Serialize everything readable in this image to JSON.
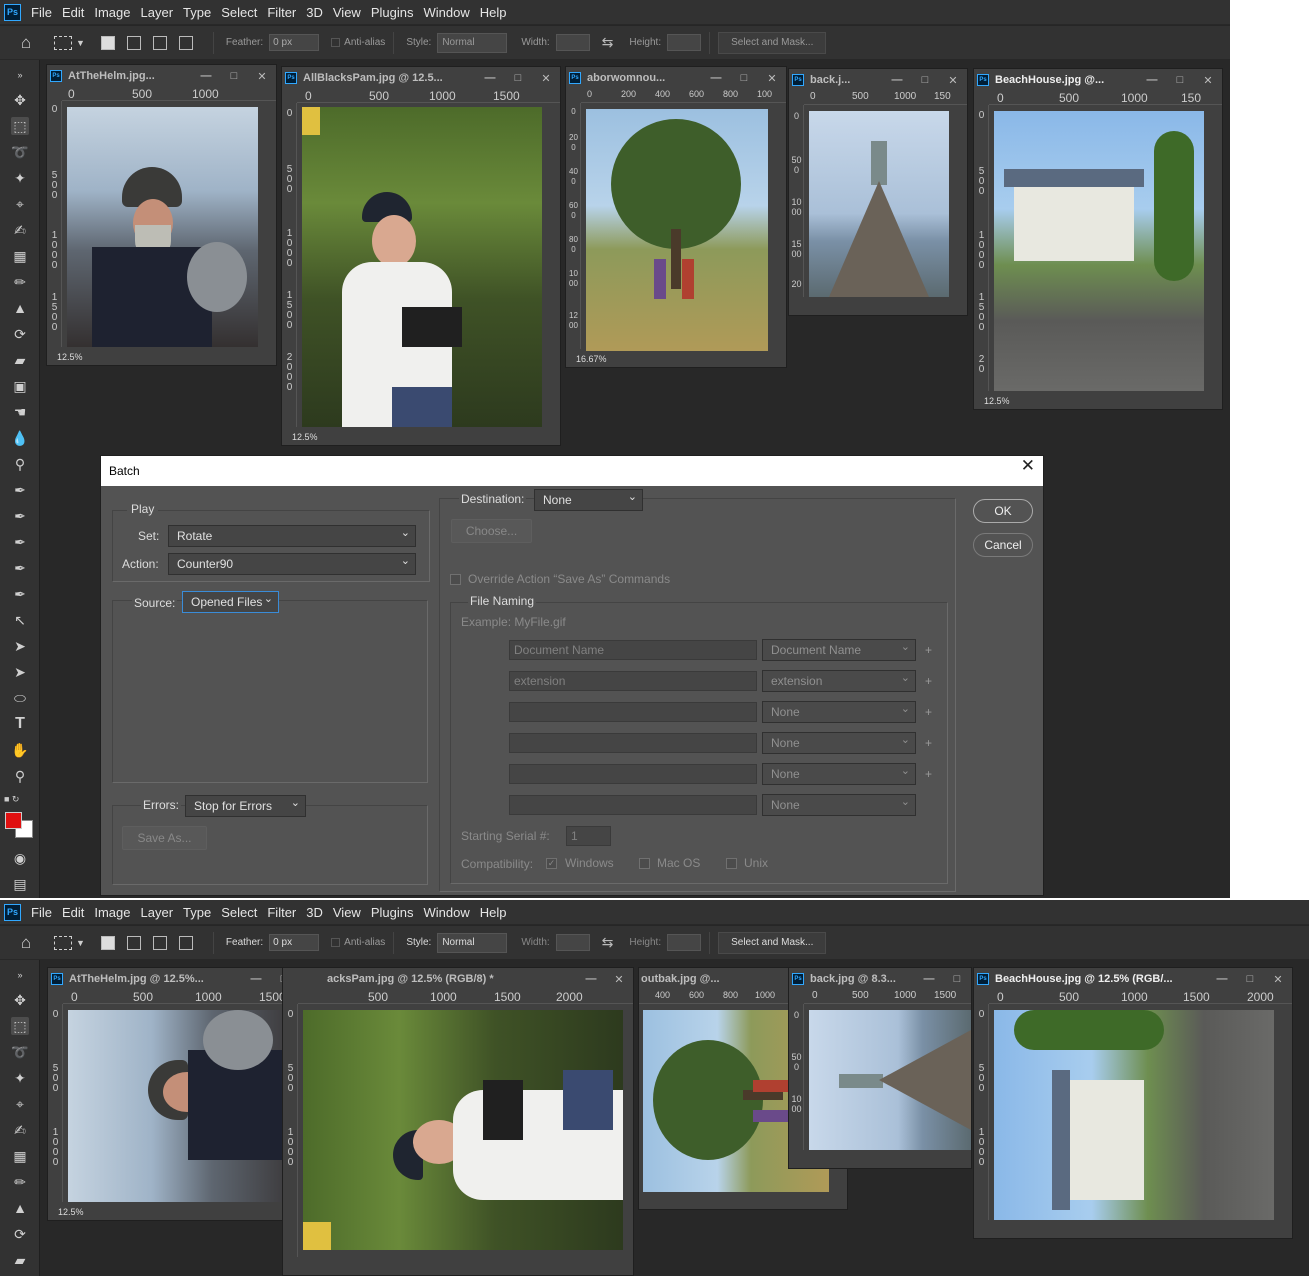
{
  "app": {
    "menus": [
      "File",
      "Edit",
      "Image",
      "Layer",
      "Type",
      "Select",
      "Filter",
      "3D",
      "View",
      "Plugins",
      "Window",
      "Help"
    ],
    "logo": "Ps"
  },
  "options_before": {
    "feather_label": "Feather:",
    "feather_value": "0 px",
    "antialias_label": "Anti-alias",
    "style_label": "Style:",
    "style_value": "Normal",
    "width_label": "Width:",
    "height_label": "Height:",
    "select_mask_label": "Select and Mask..."
  },
  "options_after": {
    "feather_label": "Feather:",
    "feather_value": "0 px",
    "antialias_label": "Anti-alias",
    "style_label": "Style:",
    "style_value": "Normal",
    "width_label": "Width:",
    "height_label": "Height:",
    "select_mask_label": "Select and Mask..."
  },
  "docs_before": [
    {
      "title": "AtTheHelm.jpg...",
      "zoom": "12.5%",
      "ruler_h": [
        "0",
        "500",
        "1000"
      ],
      "ruler_v": [
        "0",
        "500",
        "1000",
        "1500"
      ]
    },
    {
      "title": "AllBlacksPam.jpg @ 12.5...",
      "zoom": "12.5%",
      "ruler_h": [
        "0",
        "500",
        "1000",
        "1500"
      ],
      "ruler_v": [
        "0",
        "500",
        "1000",
        "1500",
        "2000"
      ]
    },
    {
      "title": "aborwomnou...",
      "zoom": "16.67%",
      "ruler_h": [
        "0",
        "200",
        "400",
        "600",
        "800",
        "100"
      ],
      "ruler_v": [
        "0",
        "200",
        "400",
        "600",
        "800",
        "1000",
        "1200"
      ]
    },
    {
      "title": "back.j...",
      "zoom": "",
      "ruler_h": [
        "0",
        "500",
        "1000",
        "150"
      ],
      "ruler_v": [
        "0",
        "500",
        "1000",
        "1500",
        "20"
      ]
    },
    {
      "title": "BeachHouse.jpg @...",
      "zoom": "12.5%",
      "ruler_h": [
        "0",
        "500",
        "1000",
        "150"
      ],
      "ruler_v": [
        "0",
        "500",
        "1000",
        "1500",
        "20"
      ]
    }
  ],
  "docs_after": [
    {
      "title": "AtTheHelm.jpg @ 12.5%...",
      "zoom": "12.5%",
      "ruler_h": [
        "0",
        "500",
        "1000",
        "1500"
      ],
      "ruler_v": [
        "0",
        "500",
        "1000"
      ]
    },
    {
      "title": "acksPam.jpg @ 12.5% (RGB/8) *",
      "zoom": "",
      "ruler_h": [
        "500",
        "1000",
        "1500",
        "2000"
      ],
      "ruler_v": [
        "0",
        "500",
        "1000"
      ]
    },
    {
      "title": "outbak.jpg @...",
      "zoom": "",
      "ruler_h": [
        "400",
        "600",
        "800",
        "1000"
      ],
      "ruler_v": []
    },
    {
      "title": "back.jpg @ 8.3...",
      "zoom": "",
      "ruler_h": [
        "0",
        "500",
        "1000",
        "1500"
      ],
      "ruler_v": [
        "0",
        "500",
        "1000"
      ]
    },
    {
      "title": "BeachHouse.jpg @ 12.5% (RGB/...",
      "zoom": "",
      "ruler_h": [
        "0",
        "500",
        "1000",
        "1500",
        "2000"
      ],
      "ruler_v": [
        "0",
        "500",
        "1000"
      ]
    }
  ],
  "batch": {
    "title": "Batch",
    "play_label": "Play",
    "set_label": "Set:",
    "set_value": "Rotate",
    "action_label": "Action:",
    "action_value": "Counter90",
    "source_label": "Source:",
    "source_value": "Opened Files",
    "errors_label": "Errors:",
    "errors_value": "Stop for Errors",
    "save_as_label": "Save As...",
    "destination_label": "Destination:",
    "destination_value": "None",
    "choose_label": "Choose...",
    "override_label": "Override Action “Save As” Commands",
    "file_naming_label": "File Naming",
    "example_label": "Example: MyFile.gif",
    "naming_rows": [
      {
        "text": "Document Name",
        "select": "Document Name",
        "plus": "+"
      },
      {
        "text": "extension",
        "select": "extension",
        "plus": "+"
      },
      {
        "text": "",
        "select": "None",
        "plus": "+"
      },
      {
        "text": "",
        "select": "None",
        "plus": "+"
      },
      {
        "text": "",
        "select": "None",
        "plus": "+"
      },
      {
        "text": "",
        "select": "None",
        "plus": ""
      }
    ],
    "serial_label": "Starting Serial #:",
    "serial_value": "1",
    "compat_label": "Compatibility:",
    "compat_windows": "Windows",
    "compat_mac": "Mac OS",
    "compat_unix": "Unix",
    "ok_label": "OK",
    "cancel_label": "Cancel",
    "check_mark": "✓"
  },
  "window_buttons": {
    "min": "—",
    "max": "□",
    "close": "✕"
  },
  "colors": {
    "foreground": "#e01010",
    "background": "#ffffff",
    "accent": "#31a8ff"
  }
}
